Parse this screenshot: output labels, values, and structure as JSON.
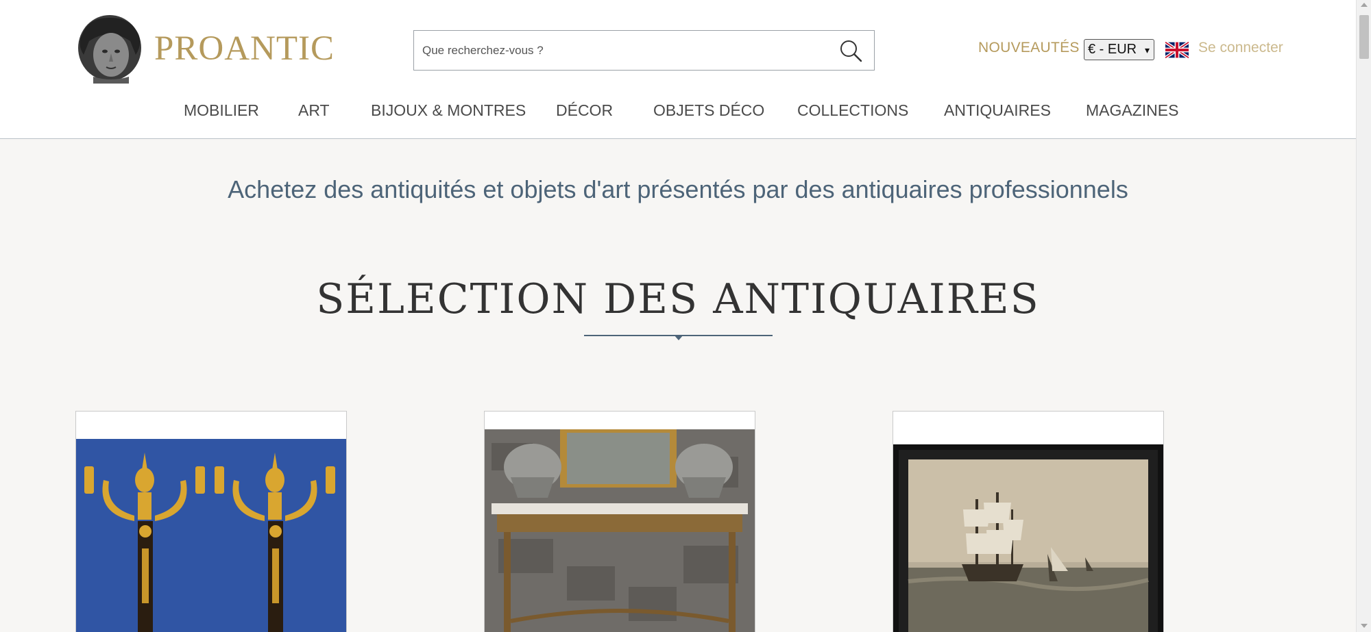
{
  "header": {
    "logo_text": "PROANTIC",
    "search_placeholder": "Que recherchez-vous ?",
    "nouveautes_label": "NOUVEAUTÉS",
    "currency_selected": "€ - EUR",
    "language_flag": "uk-flag-icon",
    "login_label": "Se connecter"
  },
  "nav": {
    "items": [
      {
        "label": "MOBILIER"
      },
      {
        "label": "ART"
      },
      {
        "label": "BIJOUX & MONTRES"
      },
      {
        "label": "DÉCOR"
      },
      {
        "label": "OBJETS DÉCO"
      },
      {
        "label": "COLLECTIONS"
      },
      {
        "label": "ANTIQUAIRES"
      },
      {
        "label": "MAGAZINES"
      }
    ]
  },
  "main": {
    "tagline": "Achetez des antiquités et objets d'art présentés par des antiquaires professionnels",
    "section_title": "SÉLECTION DES ANTIQUAIRES"
  },
  "colors": {
    "brand_gold": "#b59a5c",
    "accent_blue": "#4d6478",
    "background": "#f7f6f4"
  }
}
